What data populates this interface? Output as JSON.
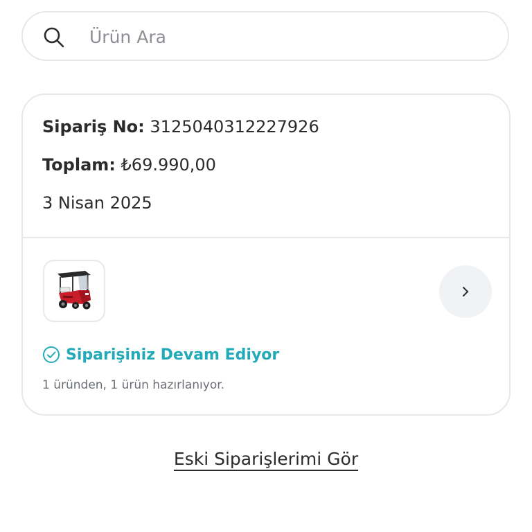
{
  "search": {
    "placeholder": "Ürün Ara",
    "icon": "search-icon"
  },
  "order": {
    "order_no_label": "Sipariş No:",
    "order_no_value": "3125040312227926",
    "total_label": "Toplam:",
    "total_value": "₺69.990,00",
    "date": "3 Nisan 2025",
    "product_image": "electric-tricycle-image",
    "status": {
      "text": "Siparişiniz Devam Ediyor",
      "icon": "check-circle-icon",
      "color": "#22aab8",
      "detail": "1 üründen, 1 ürün hazırlanıyor."
    },
    "detail_icon": "chevron-right-icon"
  },
  "footer": {
    "old_orders_label": "Eski Siparişlerimi Gör"
  },
  "colors": {
    "border": "#e6e8eb",
    "text": "#2b2b2b",
    "muted": "#6b6e73",
    "accent": "#22aab8",
    "product_red": "#c81e2a"
  }
}
